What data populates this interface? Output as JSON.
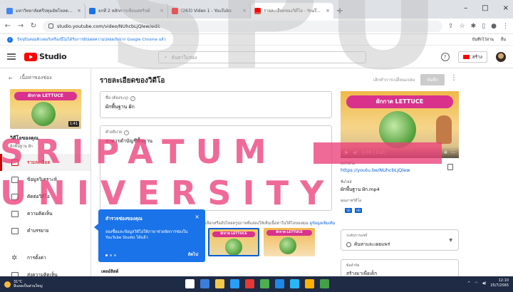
{
  "browser": {
    "tabs": [
      {
        "title": "มหาวิทยาลัยศรีปทุมอัพโหลดวิดีโอ",
        "color": "#4285f4",
        "active": false
      },
      {
        "title": "ยกที่ 2 หลักการเขียนสคริปต์",
        "color": "#1a73e8",
        "active": false
      },
      {
        "title": "(263) Video 1 - YouTube",
        "color": "#ff0000",
        "active": false
      },
      {
        "title": "รายละเอียดของวิดีโอ - YouTube Stu",
        "color": "#ff0000",
        "active": true
      }
    ],
    "url": "studio.youtube.com/video/NUhcbLjQlew/edit",
    "notice": "ปัจจุบันคอมพิวเตอร์เครื่องนี้ไม่ได้รับการอัปเดตความปลอดภัยจาก Google Chrome แล้ว",
    "bookmarks_right": [
      "บันทึกไว้อ่าน",
      "อื่น"
    ]
  },
  "studio": {
    "logo_text": "Studio",
    "search_placeholder": "ค้นหาในช่อง",
    "create_label": "สร้าง"
  },
  "sidebar": {
    "back_label": "เนื้อหาของช่อง",
    "thumb_title": "ผักกาด LETTUCE",
    "thumb_duration": "1:41",
    "your_video": "วิดีโอของคุณ",
    "video_title": "ผักพื้นฐาน ผัก",
    "items": [
      {
        "label": "รายละเอียด",
        "active": true,
        "icon": "pencil-icon"
      },
      {
        "label": "ข้อมูลวิเคราะห์",
        "active": false,
        "icon": "analytics-icon"
      },
      {
        "label": "ตัดต่อวิดีโอ",
        "active": false,
        "icon": "editor-icon"
      },
      {
        "label": "ความคิดเห็น",
        "active": false,
        "icon": "comments-icon"
      },
      {
        "label": "คำบรรยาย",
        "active": false,
        "icon": "subtitles-icon"
      },
      {
        "label": "การตั้งค่า",
        "active": false,
        "icon": "gear-icon"
      },
      {
        "label": "ส่งความคิดเห็น",
        "active": false,
        "icon": "feedback-icon"
      }
    ]
  },
  "main": {
    "title": "รายละเอียดของวิดีโอ",
    "undo_label": "เลิกทำการเปลี่ยนแปลง",
    "save_label": "บันทึก",
    "title_field": {
      "label": "ชื่อ (ต้องระบุ)",
      "value": "ผักพื้นฐาน ผัก"
    },
    "desc_field": {
      "label": "คำอธิบาย",
      "value": "อาหารตำบัญชีพื้นฐาน"
    },
    "thumb_note": "เลือกหรืออัปโหลดรูปภาพที่แสดงให้เห็นเนื้อหาในวิดีโอของคุณ",
    "thumb_note_link": "ดูข้อมูลเพิ่มเติม",
    "thumb_option_title": "ผักกาด LETTUCE",
    "playlist_label": "เพลย์ลิสต์"
  },
  "right": {
    "player_title": "ผักกาด LETTUCE",
    "player_time": "0:00 / 1:41",
    "video_link_label": "ลิงก์วิดีโอ",
    "video_link": "https://youtu.be/NUhcbLjQlew",
    "filename_label": "ชื่อไฟล์",
    "filename": "ผักพื้นฐาน ผัก.mp4",
    "quality_label": "คุณภาพวิดีโอ",
    "quality_badges": [
      "SD",
      "HD"
    ],
    "visibility_label": "ระดับการแชร์",
    "visibility_value": "ค้นหาและเผยแพร่",
    "subtitles_label": "ข้อจำกัด",
    "subtitles_value": "สร้างมาเพื่อเด็ก"
  },
  "popup": {
    "title": "สำรวจช่องของคุณ",
    "body": "ลองซื้อและข้อมูลวิดีโอให้ภาษาช่วยจัดการช่องใน YouTube Studio ได้แล้ว",
    "close": "×",
    "next_label": "ถัดไป"
  },
  "watermark": {
    "line0": "SPU",
    "line1": "SRIPATUM",
    "line2": "UNIVERSITY"
  },
  "taskbar": {
    "temp": "31°C",
    "weather": "มีแดดเป็นส่วนใหญ่",
    "time": "12:10",
    "date": "25/7/2565",
    "app_colors": [
      "#ffffff",
      "#3b7dd8",
      "#f2c94c",
      "#2a9df4",
      "#e53935",
      "#4caf50",
      "#1e88e5",
      "#29b6f6",
      "#ffb300",
      "#43a047"
    ]
  }
}
